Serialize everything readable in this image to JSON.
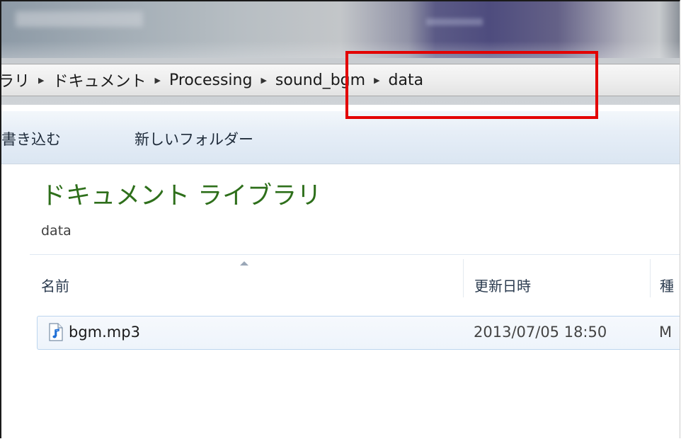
{
  "address": {
    "crumbs": [
      "ライブラリ",
      "ドキュメント",
      "Processing",
      "sound_bgm",
      "data"
    ],
    "crumb_0_visible": "ラリ"
  },
  "toolbar": {
    "burn_label": "書き込む",
    "new_folder_label": "新しいフォルダー"
  },
  "library": {
    "title": "ドキュメント ライブラリ",
    "subtitle": "data"
  },
  "columns": {
    "name": "名前",
    "date": "更新日時",
    "type": "種"
  },
  "files": [
    {
      "name": "bgm.mp3",
      "modified": "2013/07/05 18:50",
      "type": "M",
      "icon": "audio-file-icon"
    }
  ],
  "colors": {
    "highlight": "#e30000",
    "library_title": "#2e6f1b"
  }
}
